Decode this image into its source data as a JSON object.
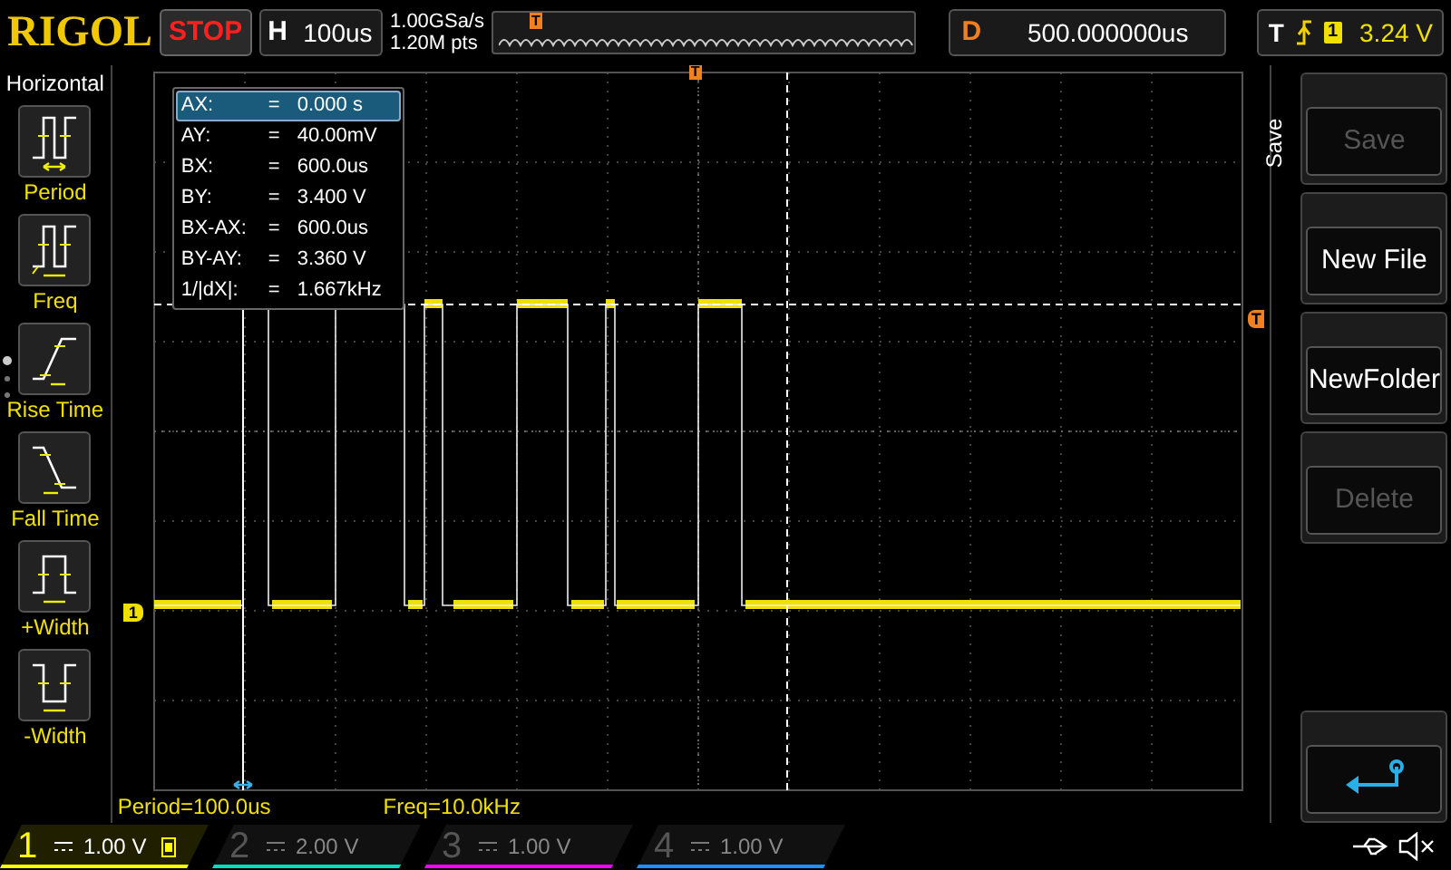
{
  "header": {
    "logo": "RIGOL",
    "run_state": "STOP",
    "timebase_label": "H",
    "timebase": "100us",
    "sample_rate": "1.00GSa/s",
    "memory_depth": "1.20M pts",
    "trigger_marker": "T",
    "delay_label": "D",
    "delay": "500.000000us",
    "trigger_label": "T",
    "trigger_source": "1",
    "trigger_level": "3.24 V"
  },
  "sidebar": {
    "title": "Horizontal",
    "items": [
      {
        "label": "Period",
        "kind": "period"
      },
      {
        "label": "Freq",
        "kind": "freq"
      },
      {
        "label": "Rise Time",
        "kind": "rise"
      },
      {
        "label": "Fall Time",
        "kind": "fall"
      },
      {
        "label": "+Width",
        "kind": "pwidth"
      },
      {
        "label": "-Width",
        "kind": "nwidth"
      }
    ]
  },
  "cursor_readout": [
    {
      "name": "AX:",
      "eq": "=",
      "value": "0.000 s",
      "selected": true
    },
    {
      "name": "AY:",
      "eq": "=",
      "value": "40.00mV",
      "selected": false
    },
    {
      "name": "BX:",
      "eq": "=",
      "value": "600.0us",
      "selected": false
    },
    {
      "name": "BY:",
      "eq": "=",
      "value": "3.400 V",
      "selected": false
    },
    {
      "name": "BX-AX:",
      "eq": "=",
      "value": "600.0us",
      "selected": false
    },
    {
      "name": "BY-AY:",
      "eq": "=",
      "value": "3.360 V",
      "selected": false
    },
    {
      "name": "1/|dX|:",
      "eq": "=",
      "value": "1.667kHz",
      "selected": false
    }
  ],
  "plot": {
    "trigger_marker": "T",
    "level_marker": "T",
    "channel_marker": "1"
  },
  "measurements": [
    "Period=100.0us",
    "Freq=10.0kHz"
  ],
  "menu": {
    "title": "Save",
    "buttons": [
      {
        "label": "Save",
        "disabled": true,
        "kind": "text"
      },
      {
        "label": "New File",
        "disabled": false,
        "kind": "text"
      },
      {
        "label": "NewFolder",
        "disabled": false,
        "kind": "text"
      },
      {
        "label": "Delete",
        "disabled": true,
        "kind": "text"
      },
      {
        "kind": "back"
      }
    ]
  },
  "channels": [
    {
      "number": "1",
      "scale": "1.00 V",
      "selected": true,
      "color": "#ffff00"
    },
    {
      "number": "2",
      "scale": "2.00 V",
      "selected": false,
      "color": "#00e0c0"
    },
    {
      "number": "3",
      "scale": "1.00 V",
      "selected": false,
      "color": "#ff00ff"
    },
    {
      "number": "4",
      "scale": "1.00 V",
      "selected": false,
      "color": "#1e90ff"
    }
  ]
}
